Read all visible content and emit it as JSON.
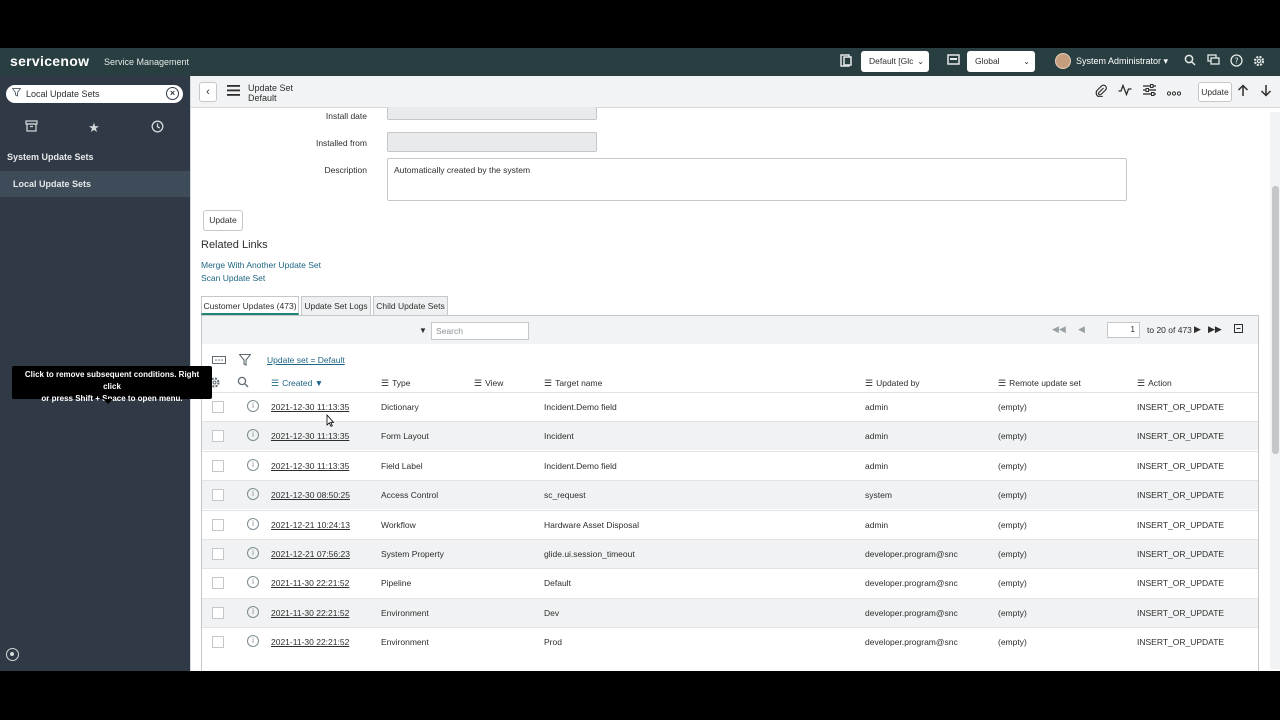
{
  "banner": {
    "logo": "servicenow",
    "product": "Service Management",
    "scope_select": "Default [Glc",
    "domain_select": "Global",
    "user_name": "System Administrator",
    "user_caret": "▾"
  },
  "sidebar": {
    "filter_text": "Local Update Sets",
    "items": [
      {
        "label": "System Update Sets"
      },
      {
        "label": "Local Update Sets"
      }
    ]
  },
  "toolbar": {
    "record_type": "Update Set",
    "record_name": "Default",
    "update_label": "Update"
  },
  "form": {
    "install_date_label": "Install date",
    "installed_from_label": "Installed from",
    "description_label": "Description",
    "description_value": "Automatically created by the system",
    "update_button": "Update"
  },
  "related_links": {
    "title": "Related Links",
    "links": [
      "Merge With Another Update Set",
      "Scan Update Set"
    ]
  },
  "tabs": [
    "Customer Updates (473)",
    "Update Set Logs",
    "Child Update Sets"
  ],
  "list": {
    "search_placeholder": "Search",
    "page_value": "1",
    "page_of": "to 20 of 473",
    "tooltip_line1": "Click to remove subsequent conditions. Right click",
    "tooltip_line2": "or press Shift + Space to open menu.",
    "breadcrumb": "Update set = Default",
    "columns": [
      "Created",
      "Type",
      "View",
      "Target name",
      "Updated by",
      "Remote update set",
      "Action"
    ],
    "sort_indicator": "▼",
    "rows": [
      {
        "created": "2021-12-30 11:13:35",
        "type": "Dictionary",
        "view": "",
        "target": "Incident.Demo field",
        "updated_by": "admin",
        "remote": "(empty)",
        "action": "INSERT_OR_UPDATE"
      },
      {
        "created": "2021-12-30 11:13:35",
        "type": "Form Layout",
        "view": "",
        "target": "Incident",
        "updated_by": "admin",
        "remote": "(empty)",
        "action": "INSERT_OR_UPDATE"
      },
      {
        "created": "2021-12-30 11:13:35",
        "type": "Field Label",
        "view": "",
        "target": "Incident.Demo field",
        "updated_by": "admin",
        "remote": "(empty)",
        "action": "INSERT_OR_UPDATE"
      },
      {
        "created": "2021-12-30 08:50:25",
        "type": "Access Control",
        "view": "",
        "target": "sc_request",
        "updated_by": "system",
        "remote": "(empty)",
        "action": "INSERT_OR_UPDATE"
      },
      {
        "created": "2021-12-21 10:24:13",
        "type": "Workflow",
        "view": "",
        "target": "Hardware Asset Disposal",
        "updated_by": "admin",
        "remote": "(empty)",
        "action": "INSERT_OR_UPDATE"
      },
      {
        "created": "2021-12-21 07:56:23",
        "type": "System Property",
        "view": "",
        "target": "glide.ui.session_timeout",
        "updated_by": "developer.program@snc",
        "remote": "(empty)",
        "action": "INSERT_OR_UPDATE"
      },
      {
        "created": "2021-11-30 22:21:52",
        "type": "Pipeline",
        "view": "",
        "target": "Default",
        "updated_by": "developer.program@snc",
        "remote": "(empty)",
        "action": "INSERT_OR_UPDATE"
      },
      {
        "created": "2021-11-30 22:21:52",
        "type": "Environment",
        "view": "",
        "target": "Dev",
        "updated_by": "developer.program@snc",
        "remote": "(empty)",
        "action": "INSERT_OR_UPDATE"
      },
      {
        "created": "2021-11-30 22:21:52",
        "type": "Environment",
        "view": "",
        "target": "Prod",
        "updated_by": "developer.program@snc",
        "remote": "(empty)",
        "action": "INSERT_OR_UPDATE"
      }
    ]
  }
}
